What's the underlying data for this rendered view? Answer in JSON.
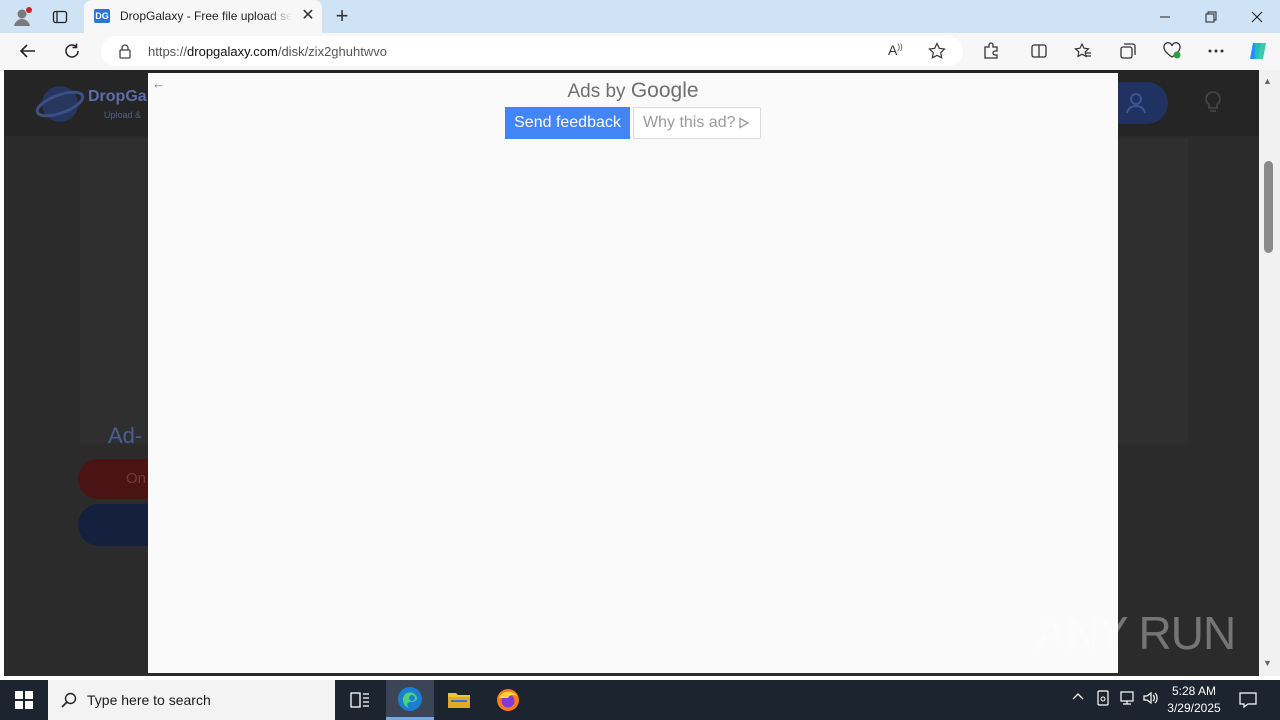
{
  "browser": {
    "tab_title": "DropGalaxy - Free file upload ser",
    "tab_favicon": "DG",
    "url_domain": "dropgalaxy.com",
    "url_prefix": "https://",
    "url_path": "/disk/zix2ghuhtwvo"
  },
  "site": {
    "name": "DropGa",
    "tagline": "Upload &",
    "ad_heading": "Ad-",
    "red_button_label": "On"
  },
  "ad": {
    "ads_by": "Ads by",
    "google": "Google",
    "send_feedback": "Send feedback",
    "why_this_ad": "Why this ad?"
  },
  "watermark": "ANY RUN",
  "taskbar": {
    "search_placeholder": "Type here to search",
    "time": "5:28 AM",
    "date": "3/29/2025"
  },
  "colors": {
    "titlebar": "#cfe3f6",
    "feedback_button": "#4285f4",
    "taskbar": "#1c2430"
  }
}
